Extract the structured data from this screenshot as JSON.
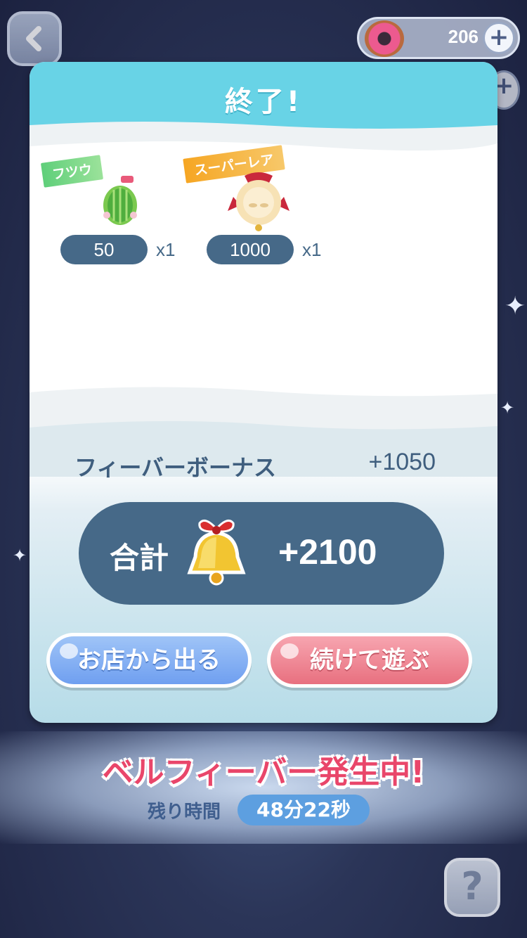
{
  "top_bar": {
    "back_icon": "chevron-left-icon",
    "donut_icon": "donut-icon",
    "donut_count": "206",
    "plus_symbol": "+"
  },
  "modal": {
    "title": "終了!",
    "items": [
      {
        "rarity": "フツウ",
        "character_icon": "cactus-character-icon",
        "count": "50",
        "multiplier": "x1"
      },
      {
        "rarity": "スーパーレア",
        "character_icon": "pufferfish-character-icon",
        "count": "1000",
        "multiplier": "x1"
      }
    ],
    "fever_bonus_label": "フィーバーボーナス",
    "fever_bonus_value": "+1050",
    "total_label": "合計",
    "total_icon": "bell-icon",
    "total_value": "+2100",
    "leave_button": "お店から出る",
    "continue_button": "続けて遊ぶ"
  },
  "fever": {
    "banner": "ベルフィーバー発生中!",
    "remaining_label": "残り時間",
    "remaining_time": "48分22秒"
  },
  "help_button": "?",
  "colors": {
    "header_cyan": "#68d3e6",
    "dark_pill": "#466988",
    "leave_blue": "#6f9ff0",
    "continue_pink": "#e8707f",
    "fever_red": "#e9466a",
    "time_blue": "#5d9fe0"
  }
}
